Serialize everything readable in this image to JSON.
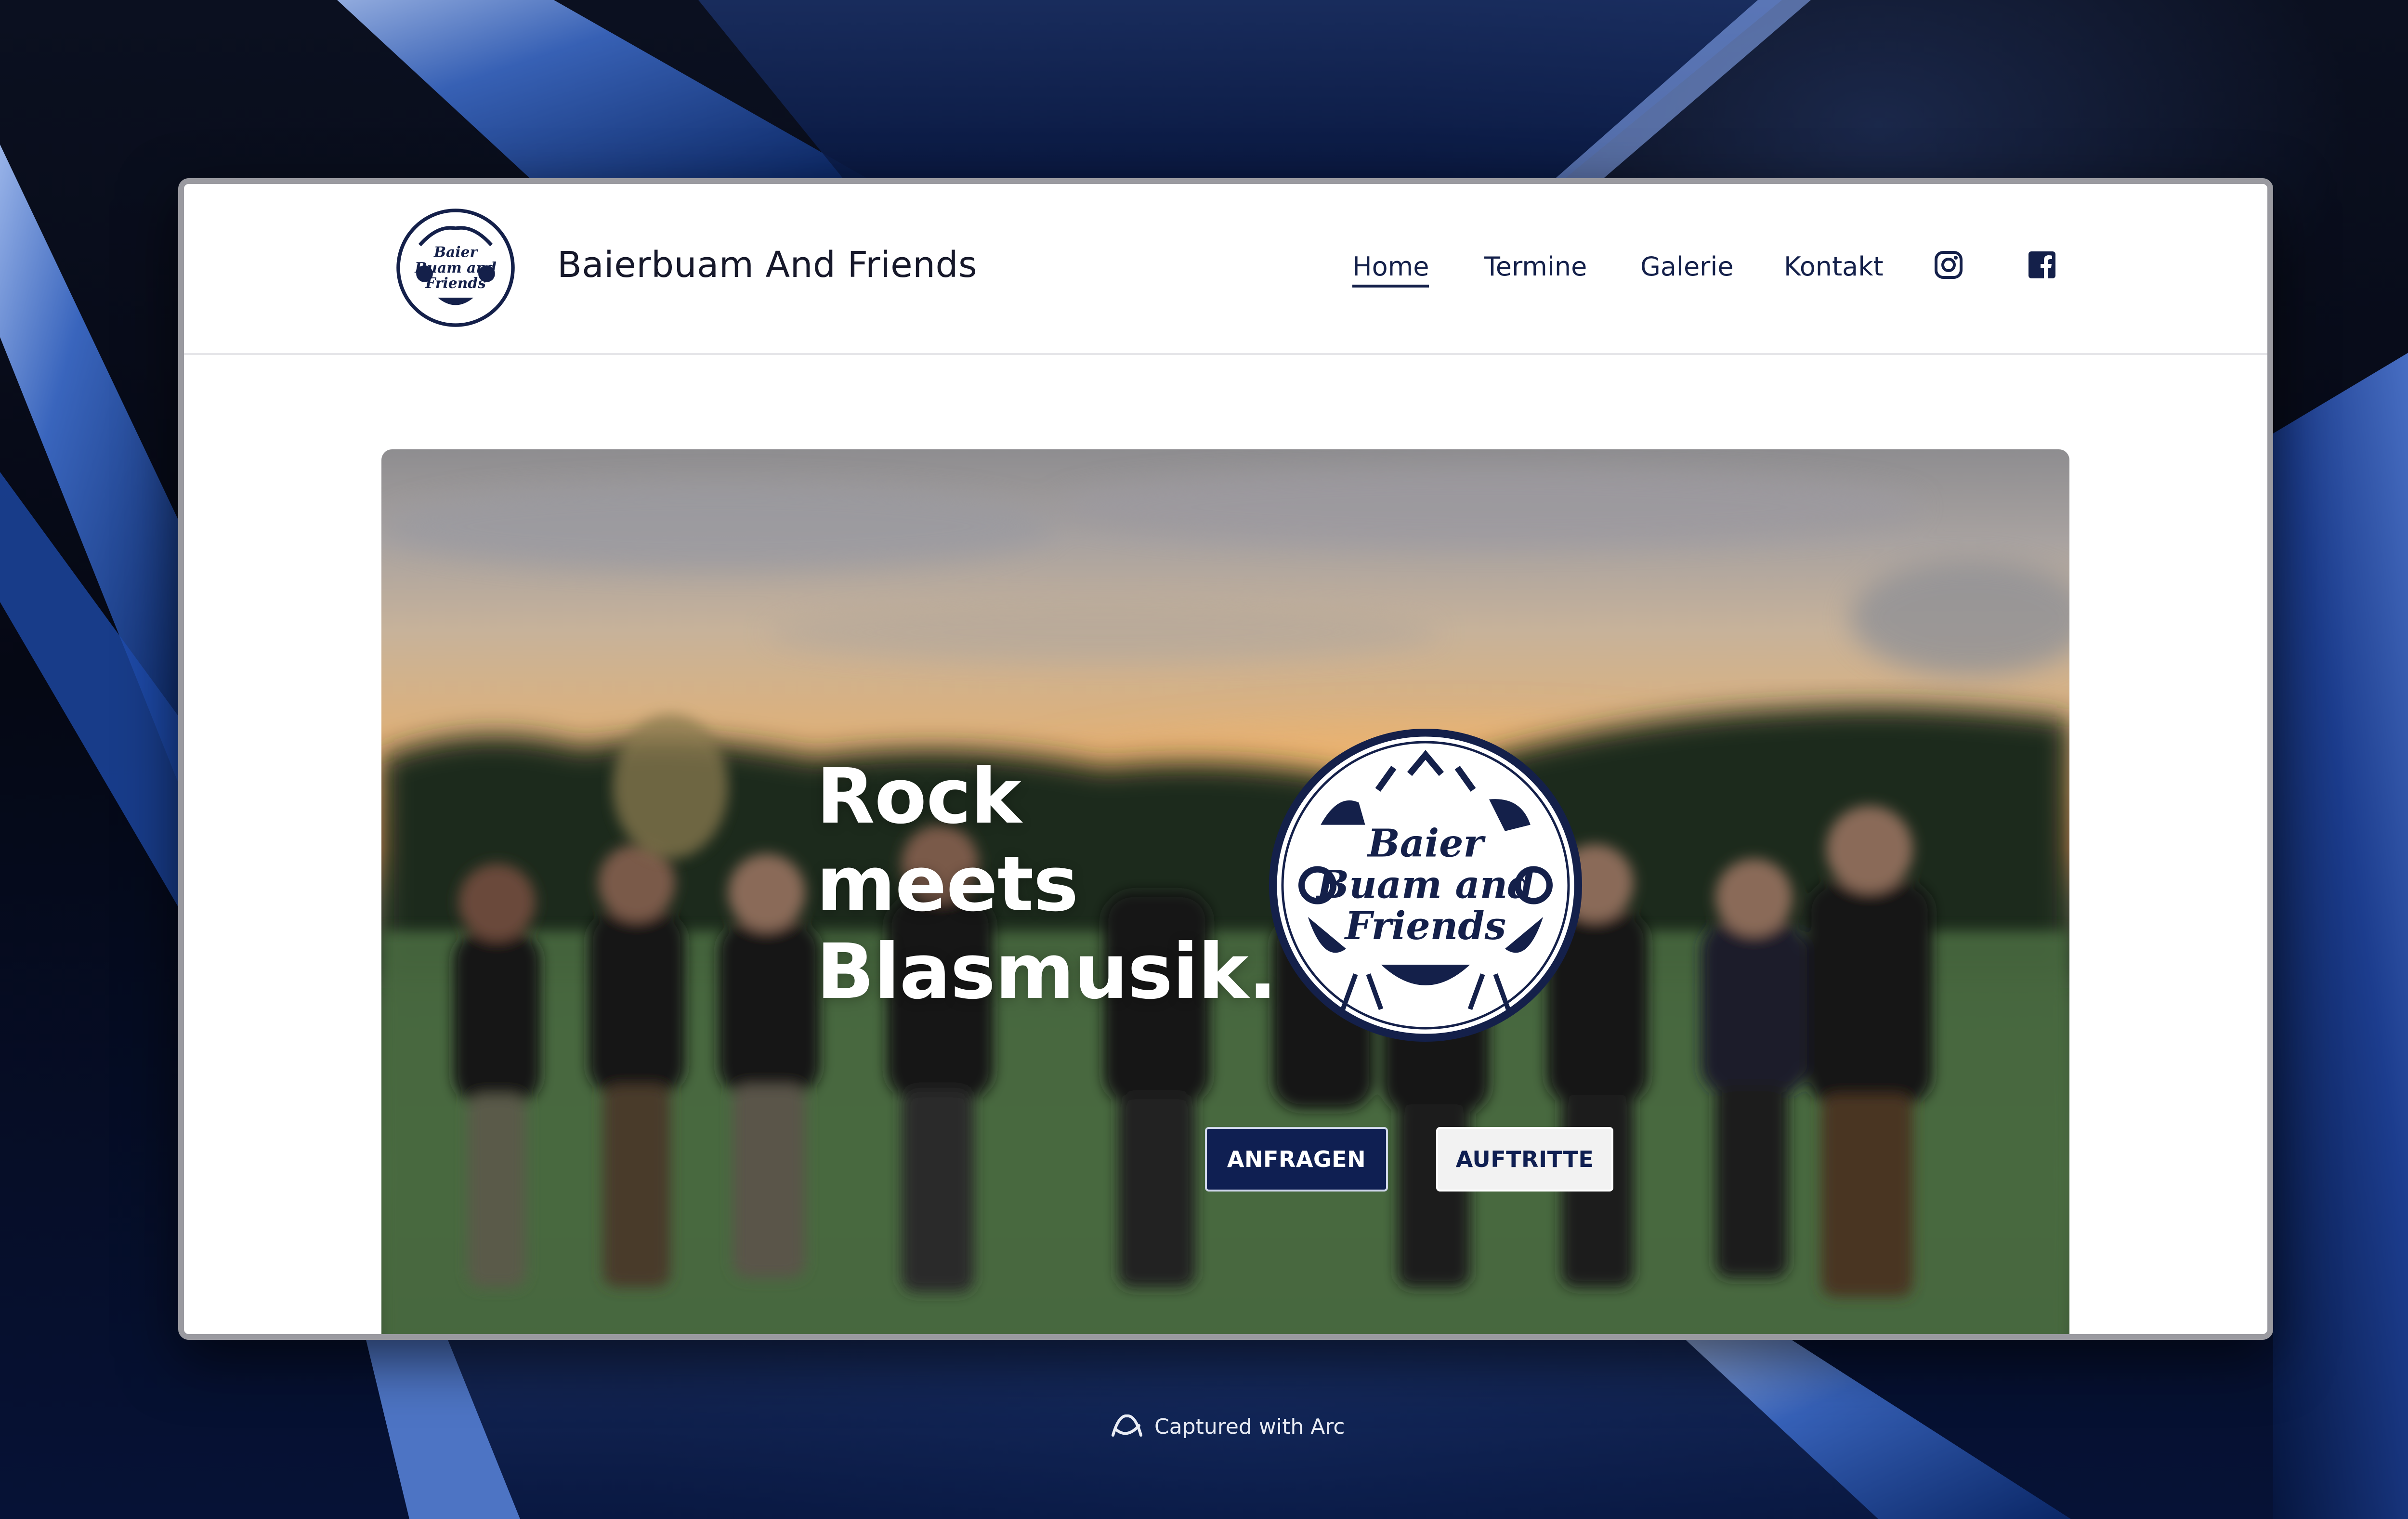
{
  "site": {
    "title": "Baierbuam And Friends",
    "logo_text": [
      "Baier",
      "Buam and",
      "Friends"
    ]
  },
  "nav": {
    "items": [
      {
        "label": "Home",
        "active": true
      },
      {
        "label": "Termine",
        "active": false
      },
      {
        "label": "Galerie",
        "active": false
      },
      {
        "label": "Kontakt",
        "active": false
      }
    ],
    "social": [
      {
        "icon": "instagram-icon"
      },
      {
        "icon": "facebook-icon"
      }
    ]
  },
  "hero": {
    "heading_lines": [
      "Rock",
      "meets",
      "Blasmusik."
    ],
    "primary_button": "ANFRAGEN",
    "secondary_button": "AUFTRITTE"
  },
  "footer": {
    "capture_text": "Captured with Arc"
  },
  "colors": {
    "brand_navy": "#0f1f52",
    "nav_text": "#14204a",
    "heading_text": "#ffffff"
  }
}
